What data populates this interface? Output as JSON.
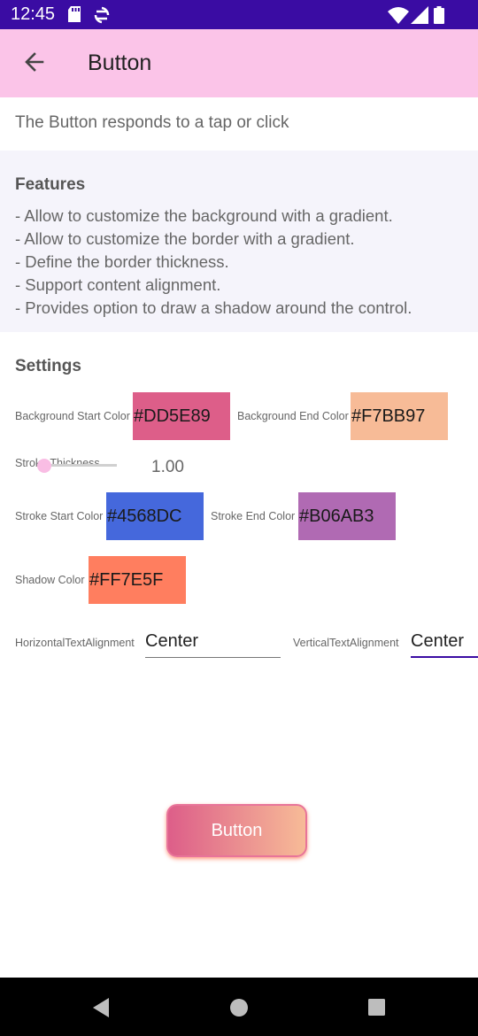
{
  "status_bar": {
    "time": "12:45",
    "icons": [
      "sd-card-icon",
      "sync-icon",
      "wifi-icon",
      "signal-icon",
      "battery-icon"
    ]
  },
  "toolbar": {
    "title": "Button",
    "back_icon": "arrow-back-icon"
  },
  "description": "The Button responds to a tap or click",
  "features": {
    "title": "Features",
    "items": [
      "- Allow to customize the background with a gradient.",
      "- Allow to customize the border with a gradient.",
      "- Define the border thickness.",
      "- Support content alignment.",
      "- Provides option to draw a shadow around the control."
    ]
  },
  "settings": {
    "title": "Settings",
    "background_start": {
      "label": "Background Start Color",
      "value": "#DD5E89",
      "color": "#DD5E89"
    },
    "background_end": {
      "label": "Background End Color",
      "value": "#F7BB97",
      "color": "#F7BB97"
    },
    "stroke_thickness": {
      "label": "Stroke Thickness",
      "value": "1.00"
    },
    "stroke_start": {
      "label": "Stroke Start Color",
      "value": "#4568DC",
      "color": "#4568DC"
    },
    "stroke_end": {
      "label": "Stroke End Color",
      "value": "#B06AB3",
      "color": "#B06AB3"
    },
    "shadow": {
      "label": "Shadow Color",
      "value": "#FF7E5F",
      "color": "#FF7E5F"
    },
    "horizontal_alignment": {
      "label": "HorizontalTextAlignment",
      "value": "Center"
    },
    "vertical_alignment": {
      "label": "VerticalTextAlignment",
      "value": "Center"
    }
  },
  "demo_button": {
    "label": "Button"
  },
  "nav_bar": {
    "icons": [
      "back-nav-icon",
      "home-nav-icon",
      "recents-nav-icon"
    ]
  }
}
